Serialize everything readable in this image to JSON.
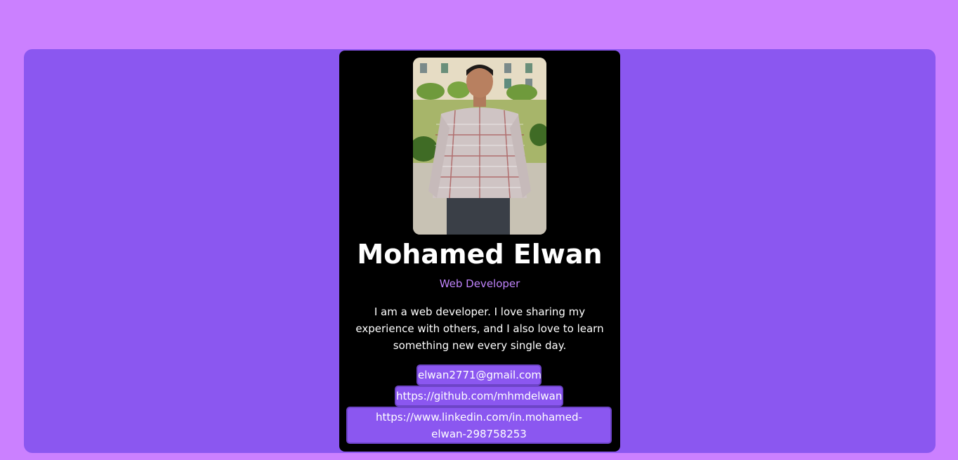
{
  "profile": {
    "name": "Mohamed Elwan",
    "role": "Web Developer",
    "bio": "I am a web developer. I love sharing my experience with others, and I also love to learn something new every single day.",
    "photo_alt": "Mohamed Elwan"
  },
  "links": {
    "email": "elwan2771@gmail.com",
    "github": "https://github.com/mhmdelwan",
    "linkedin": "https://www.linkedin.com/in.mohamed-elwan-298758253"
  },
  "colors": {
    "page_bg": "#cb80ff",
    "panel_bg": "#8b57f0",
    "card_bg": "#000000",
    "accent_text": "#c084fc",
    "link_bg": "#8b57f0"
  }
}
